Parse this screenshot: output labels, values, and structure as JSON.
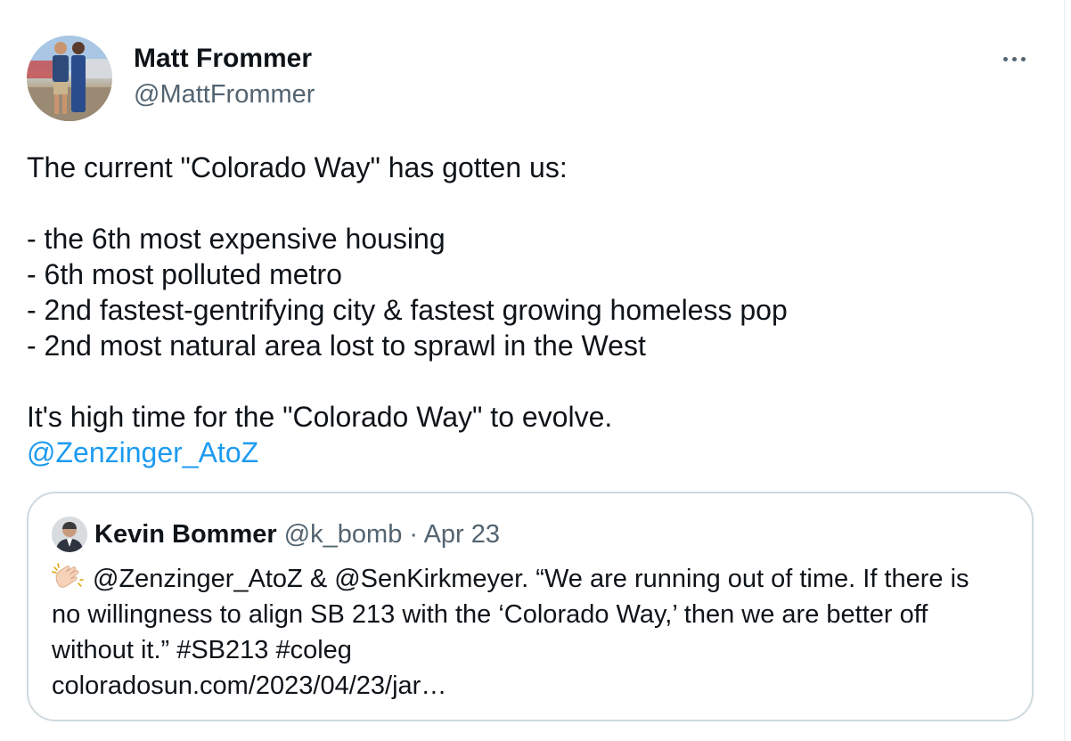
{
  "tweet": {
    "author": {
      "name": "Matt Frommer",
      "handle": "@MattFrommer"
    },
    "more_icon": "more-horizontal-icon",
    "lines": [
      "The current \"Colorado Way\" has gotten us:",
      "",
      "- the 6th most expensive housing",
      "- 6th most polluted metro",
      "- 2nd fastest-gentrifying city & fastest growing homeless pop",
      "- 2nd most natural area lost to sprawl in the West",
      "",
      "It's high time for the \"Colorado Way\" to evolve."
    ],
    "mention": "@Zenzinger_AtoZ"
  },
  "quote": {
    "author": {
      "name": "Kevin Bommer",
      "handle": "@k_bomb",
      "separator": "·",
      "date": "Apr 23"
    },
    "clap_icon": "clapping-hands-icon",
    "line1": "@Zenzinger_AtoZ & @SenKirkmeyer. “We are running out of time. If there is",
    "line2": "no willingness to align SB 213 with the ‘Colorado Way,’ then we are better off",
    "line3": "without it.” #SB213 #coleg",
    "line4": "coloradosun.com/2023/04/23/jar…"
  },
  "colors": {
    "link": "#1d9bf0",
    "secondary": "#536471",
    "text": "#0f1419",
    "border": "#cfd9de"
  }
}
